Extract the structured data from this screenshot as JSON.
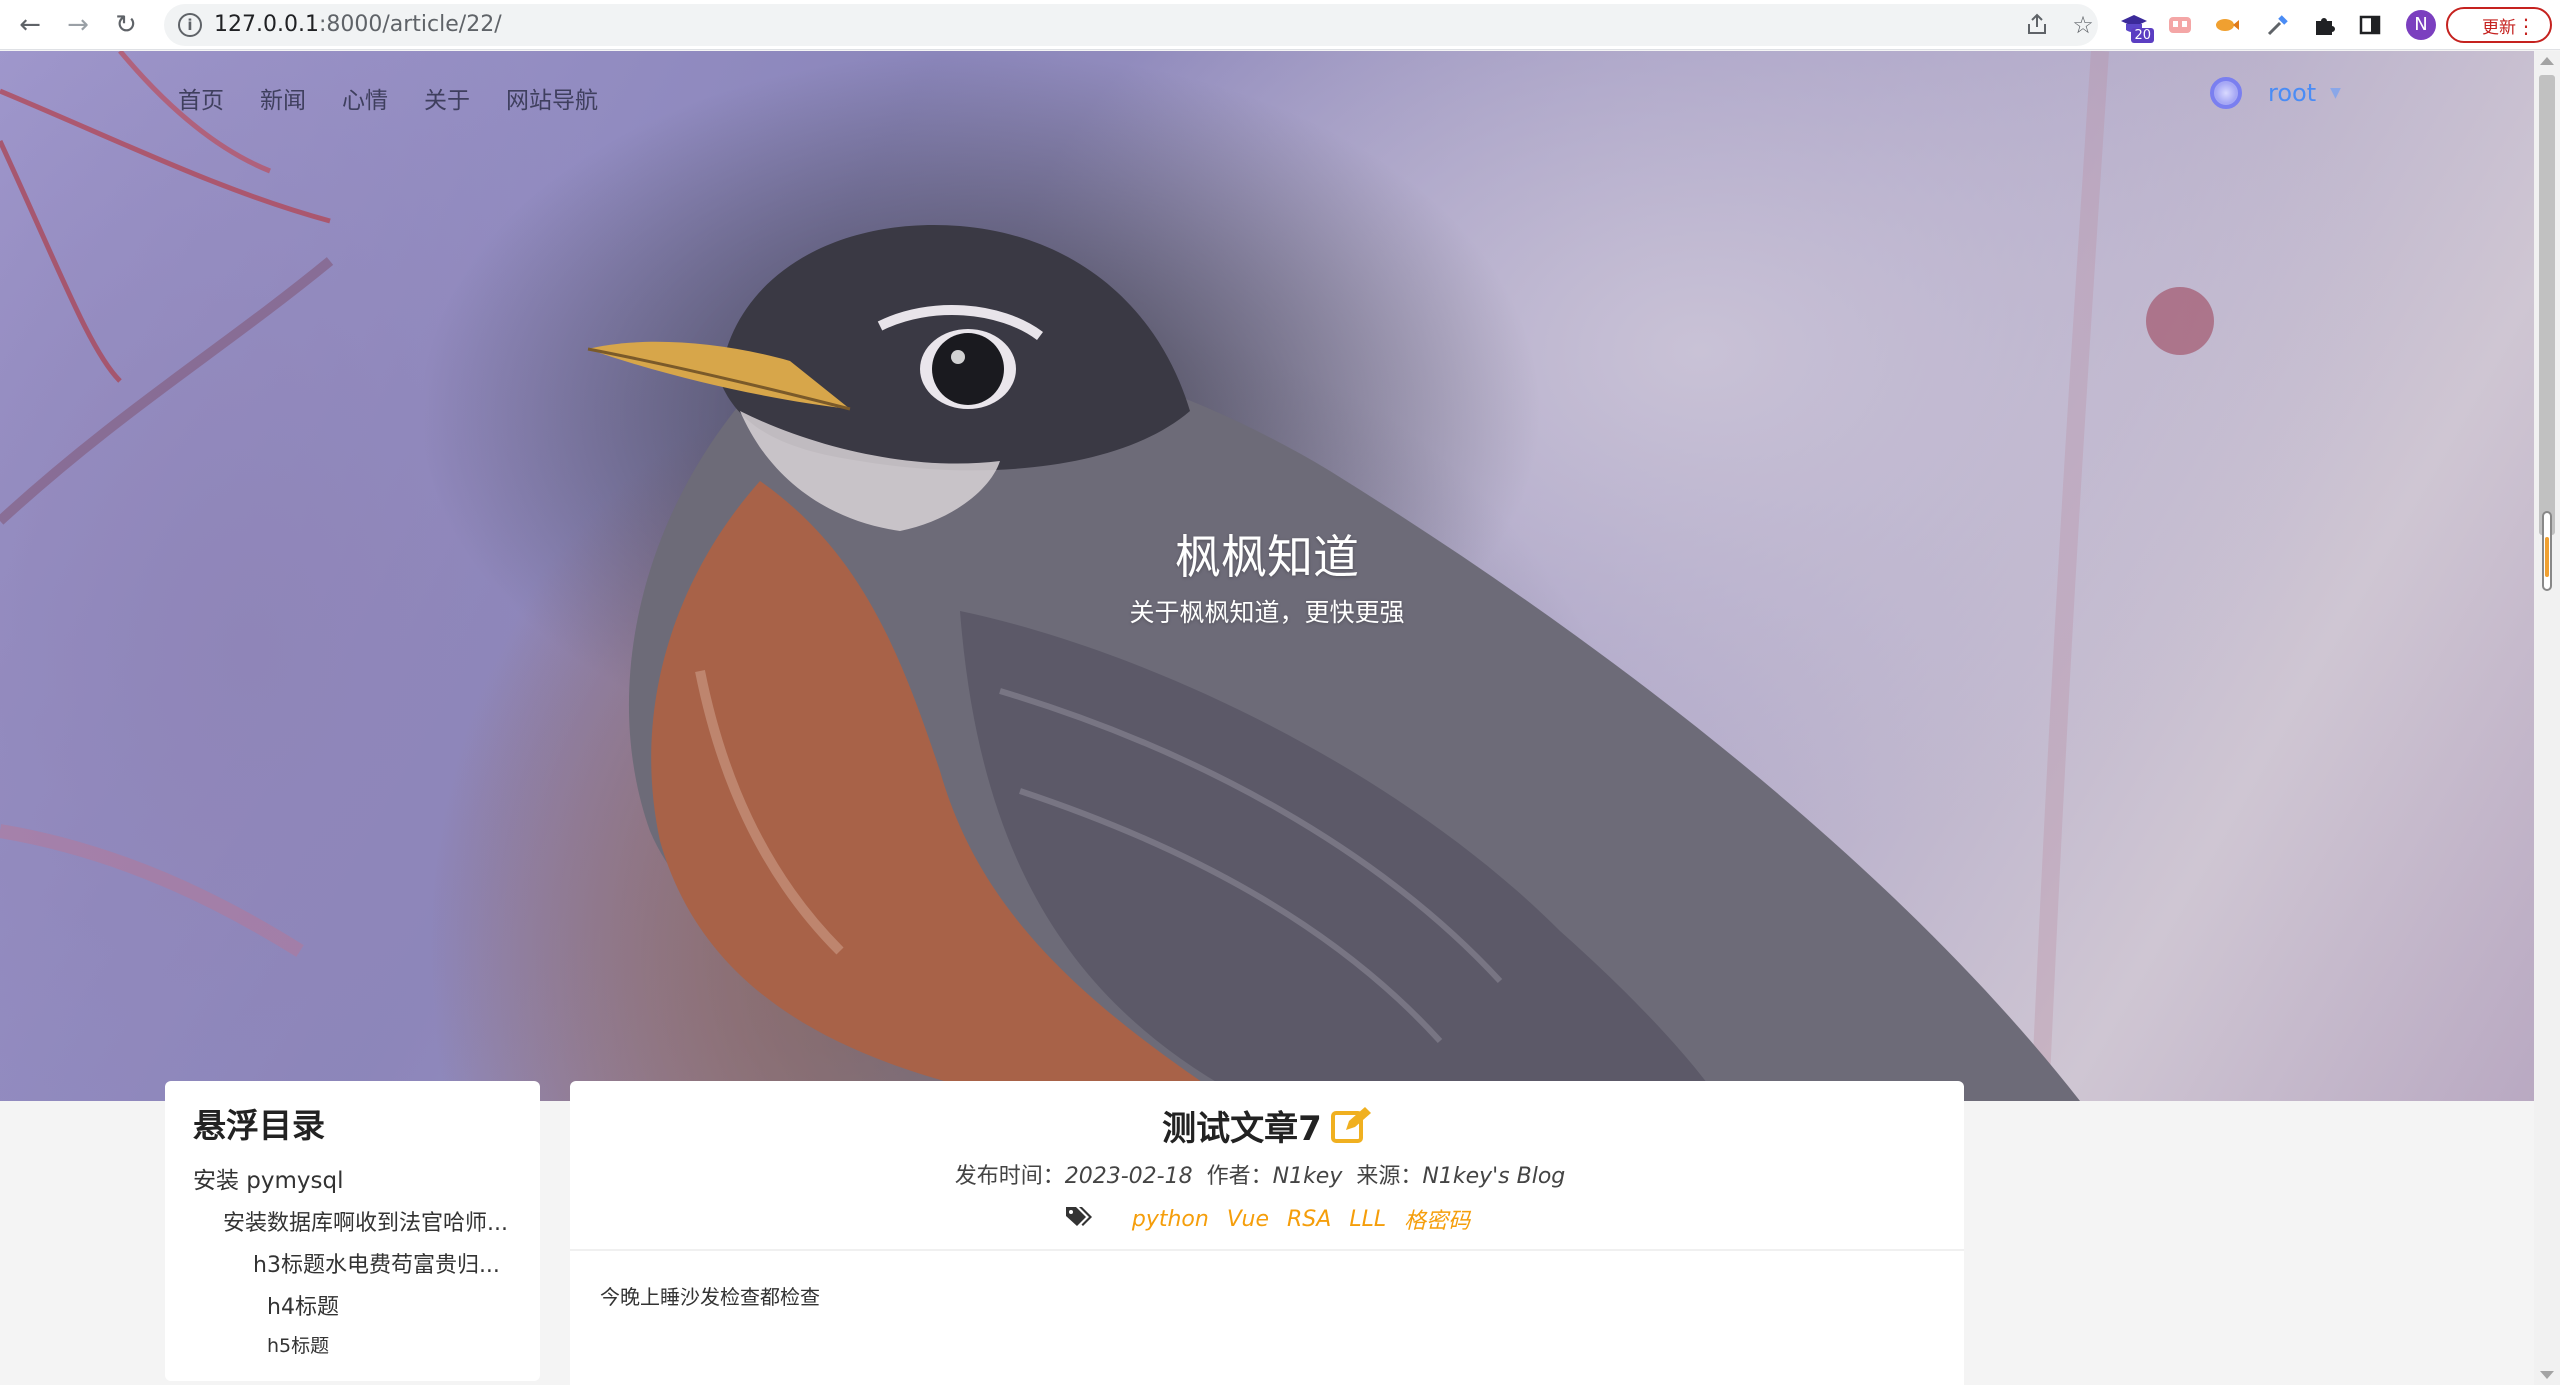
{
  "browser": {
    "url_host": "127.0.0.1",
    "url_rest": ":8000/article/22/",
    "extension_badge": "20",
    "profile_initial": "N",
    "update_label": "更新"
  },
  "site": {
    "nav": [
      "首页",
      "新闻",
      "心情",
      "关于",
      "网站导航"
    ],
    "user_name": "root",
    "hero_title": "枫枫知道",
    "hero_subtitle": "关于枫枫知道，更快更强"
  },
  "toc": {
    "title": "悬浮目录",
    "items": [
      "安装 pymysql",
      "安装数据库啊收到法官哈师...",
      "h3标题水电费苟富贵归...",
      "h4标题",
      "h5标题"
    ]
  },
  "article": {
    "title": "测试文章7",
    "publish_label": "发布时间：",
    "publish_date": "2023-02-18",
    "author_label": "作者：",
    "author": "N1key",
    "source_label": "来源：",
    "source": "N1key's Blog",
    "tags": [
      "python",
      "Vue",
      "RSA",
      "LLL",
      "格密码"
    ],
    "body": "今晚上睡沙发检查都检查"
  },
  "colors": {
    "accent_tag": "#f59e0b",
    "user_link": "#4a8cf5",
    "update_red": "#c5221f"
  }
}
